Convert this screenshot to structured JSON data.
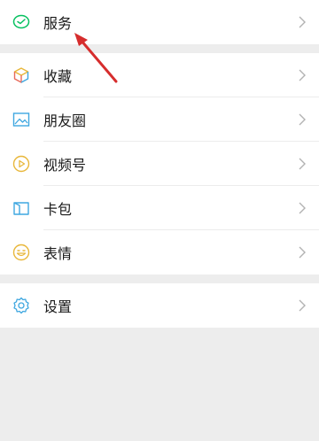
{
  "menu": {
    "group1": [
      {
        "label": "服务",
        "icon": "service-icon"
      }
    ],
    "group2": [
      {
        "label": "收藏",
        "icon": "favorites-icon"
      },
      {
        "label": "朋友圈",
        "icon": "moments-icon"
      },
      {
        "label": "视频号",
        "icon": "channels-icon"
      },
      {
        "label": "卡包",
        "icon": "cards-icon"
      },
      {
        "label": "表情",
        "icon": "stickers-icon"
      }
    ],
    "group3": [
      {
        "label": "设置",
        "icon": "settings-icon"
      }
    ]
  },
  "colors": {
    "accent_green": "#07c160",
    "arrow_red": "#d62d2d",
    "chevron": "#b2b2b2"
  }
}
